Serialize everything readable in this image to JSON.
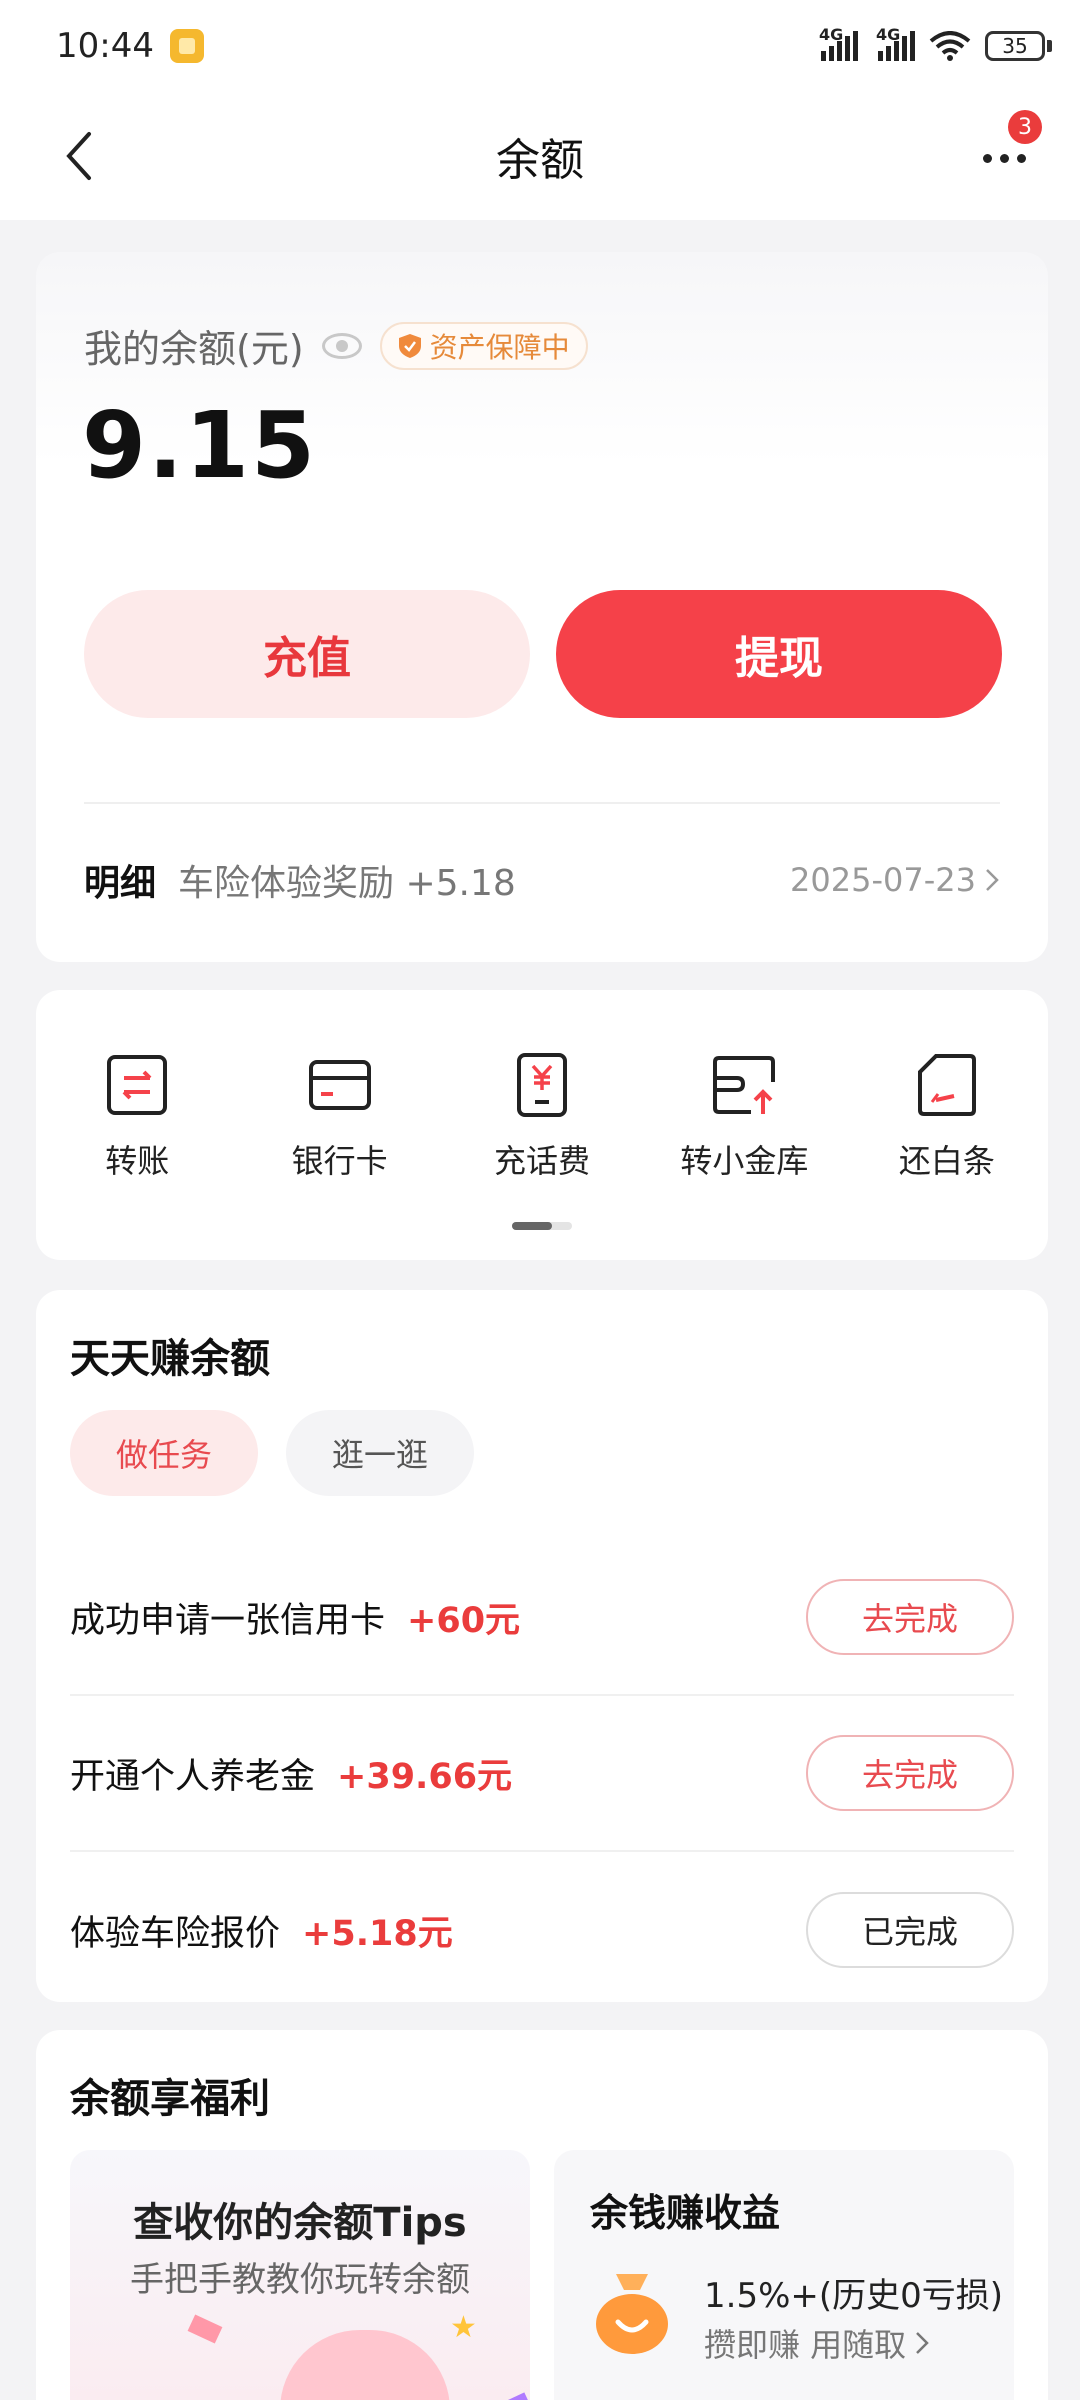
{
  "status_bar": {
    "time": "10:44",
    "network_1": "4G",
    "network_2": "4G",
    "battery": "35"
  },
  "nav": {
    "title": "余额",
    "badge_count": "3"
  },
  "balance": {
    "label": "我的余额(元)",
    "protect_text": "资产保障中",
    "amount": "9.15",
    "recharge_label": "充值",
    "withdraw_label": "提现",
    "detail_label": "明细",
    "detail_desc": "车险体验奖励 +5.18",
    "detail_date": "2025-07-23"
  },
  "actions": [
    {
      "label": "转账",
      "icon": "transfer-icon"
    },
    {
      "label": "银行卡",
      "icon": "bank-card-icon"
    },
    {
      "label": "充话费",
      "icon": "phone-recharge-icon"
    },
    {
      "label": "转小金库",
      "icon": "vault-transfer-icon"
    },
    {
      "label": "还白条",
      "icon": "repay-icon"
    }
  ],
  "tasks": {
    "title": "天天赚余额",
    "tabs": [
      "做任务",
      "逛一逛"
    ],
    "items": [
      {
        "title": "成功申请一张信用卡",
        "reward": "+60元",
        "button": "去完成"
      },
      {
        "title": "开通个人养老金",
        "reward": "+39.66元",
        "button": "去完成"
      },
      {
        "title": "体验车险报价",
        "reward": "+5.18元",
        "button": "已完成"
      }
    ]
  },
  "benefits": {
    "title": "余额享福利",
    "tips_title": "查收你的余额Tips",
    "tips_sub": "手把手教教你玩转余额",
    "earn_title": "余钱赚收益",
    "earn_rate": "1.5%+(历史0亏损)",
    "earn_sub": "攒即赚 用随取"
  },
  "colors": {
    "accent": "#f54149",
    "accent_light": "#fdeaea",
    "warning": "#e68a3a"
  }
}
